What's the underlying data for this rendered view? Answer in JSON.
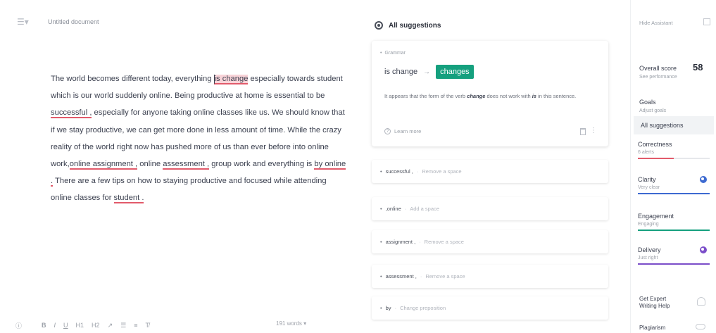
{
  "editor": {
    "menu_icon": "hamburger-menu-icon",
    "doc_title": "Untitled document",
    "text": {
      "s1": "The world becomes different today, everything",
      "err1": "is change",
      "s2": " especially towards student which is our world suddenly online. Being productive at home is essential to be",
      "err2": "successful ,",
      "s3": " especially for anyone taking online classes like us. We should know that if we stay productive, we can get more done in less amount of time. While the crazy reality of the world right now has pushed more of us than ever before into online work,",
      "err3": "online assignment ,",
      "s4": " online",
      "err4": "assessment ,",
      "s5": " group work and everything is",
      "err5": "by online .",
      "s6": " There are a few tips on how to staying productive and focused while attending online classes for",
      "err6": "student ."
    },
    "toolbar": {
      "info": "ⓘ",
      "bold": "B",
      "italic": "I",
      "underline": "U",
      "h1": "H1",
      "h2": "H2",
      "link": "↗",
      "ol": "☰",
      "ul": "≡",
      "clear": "T̸",
      "word_count": "191 words ▾"
    }
  },
  "suggestions": {
    "header": "All suggestions",
    "main_card": {
      "category": "Grammar",
      "original": "is change",
      "arrow": "→",
      "replacement": "changes",
      "explain_pre": "It appears that the form of the verb ",
      "explain_verb": "change",
      "explain_mid": " does not work with ",
      "explain_is": "is",
      "explain_post": " in this sentence.",
      "learn_more": "Learn more"
    },
    "cards": [
      {
        "word": "successful ,",
        "action": "Remove a space"
      },
      {
        "word": ",online",
        "action": "Add a space"
      },
      {
        "word": "assignment ,",
        "action": "Remove a space"
      },
      {
        "word": "assessment ,",
        "action": "Remove a space"
      },
      {
        "word": "by",
        "action": "Change preposition"
      }
    ]
  },
  "assistant": {
    "hide": "Hide Assistant",
    "score_label": "Overall score",
    "score_value": "58",
    "score_sub": "See performance",
    "goals_label": "Goals",
    "goals_sub": "Adjust goals",
    "all_suggestions": "All suggestions",
    "categories": [
      {
        "label": "Correctness",
        "sub": "6 alerts",
        "color": "#e25b6b",
        "bar_fill": 0.5
      },
      {
        "label": "Clarity",
        "sub": "Very clear",
        "color": "#3d6ad1",
        "bar_fill": 1.0
      },
      {
        "label": "Engagement",
        "sub": "Engaging",
        "color": "#15a07e",
        "bar_fill": 1.0
      },
      {
        "label": "Delivery",
        "sub": "Just right",
        "color": "#7b4ec9",
        "bar_fill": 1.0
      }
    ],
    "expert": "Get Expert Writing Help",
    "plagiarism": "Plagiarism"
  }
}
